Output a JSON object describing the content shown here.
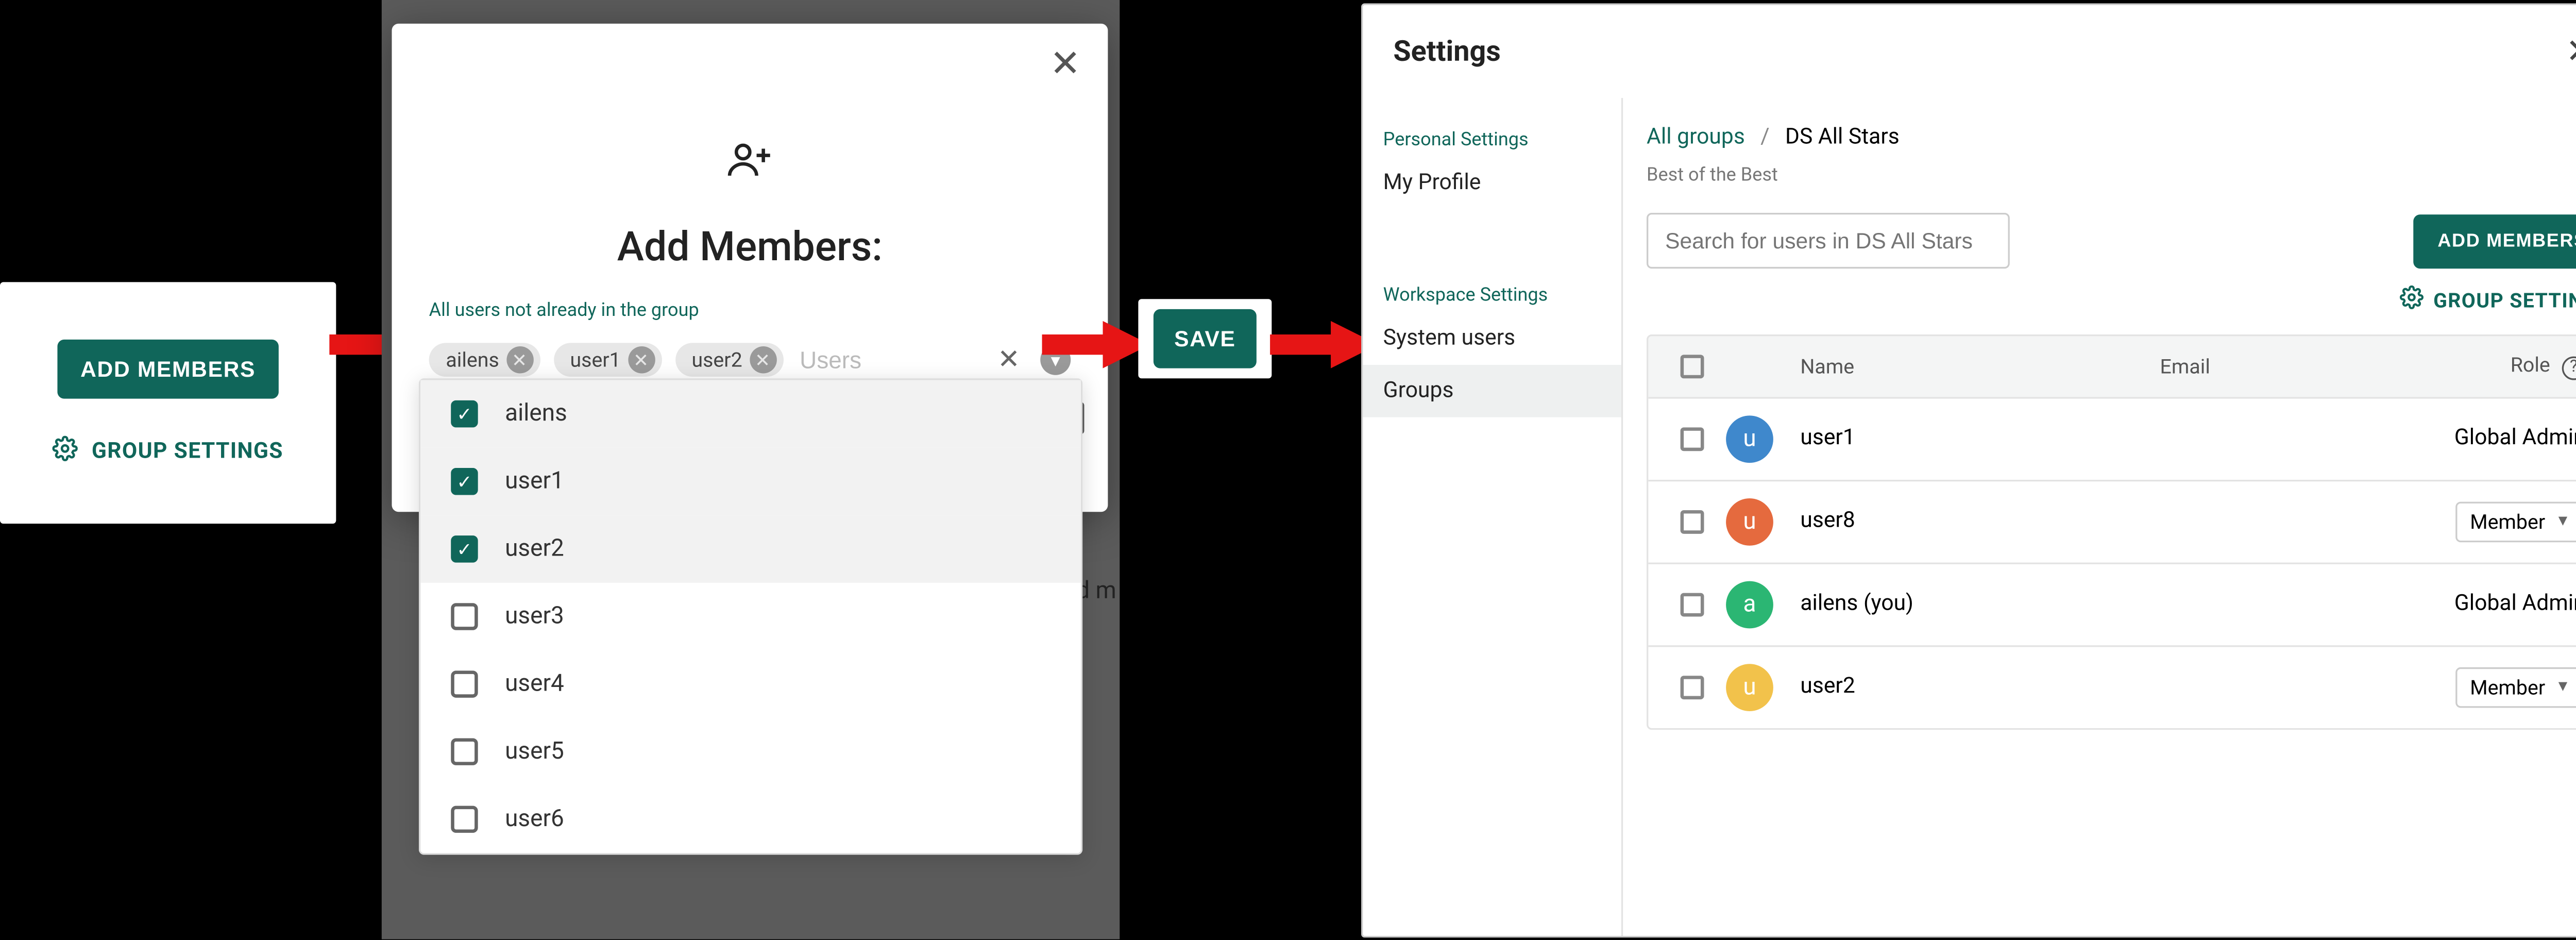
{
  "panel1": {
    "add_members_btn": "ADD MEMBERS",
    "group_settings_link": "GROUP SETTINGS"
  },
  "dialog": {
    "title": "Add Members:",
    "chip_label": "All users not already in the group",
    "placeholder": "Users",
    "close_tooltip": "Close",
    "chips": [
      {
        "label": "ailens"
      },
      {
        "label": "user1"
      },
      {
        "label": "user2"
      }
    ],
    "options": [
      {
        "label": "ailens",
        "checked": true
      },
      {
        "label": "user1",
        "checked": true
      },
      {
        "label": "user2",
        "checked": true
      },
      {
        "label": "user3",
        "checked": false
      },
      {
        "label": "user4",
        "checked": false
      },
      {
        "label": "user5",
        "checked": false
      },
      {
        "label": "user6",
        "checked": false
      }
    ],
    "peek_text": "Add m"
  },
  "save_btn": "SAVE",
  "settings": {
    "title": "Settings",
    "sidebar": {
      "personal_heading": "Personal Settings",
      "my_profile": "My Profile",
      "workspace_heading": "Workspace Settings",
      "system_users": "System users",
      "groups": "Groups"
    },
    "breadcrumb": {
      "root": "All groups",
      "current": "DS All Stars"
    },
    "subtitle": "Best of the Best",
    "search_placeholder": "Search for users in DS All Stars",
    "add_members_btn": "ADD MEMBERS",
    "group_settings_link": "GROUP SETTINGS",
    "table": {
      "headers": {
        "name": "Name",
        "email": "Email",
        "role": "Role"
      },
      "rows": [
        {
          "initial": "u",
          "color": "#3f88cc",
          "name": "user1",
          "email": "",
          "role_text": "Global Admin",
          "role_pill": false
        },
        {
          "initial": "u",
          "color": "#e56a3e",
          "name": "user8",
          "email": "",
          "role_text": "Member",
          "role_pill": true
        },
        {
          "initial": "a",
          "color": "#2bb673",
          "name": "ailens (you)",
          "email": "",
          "role_text": "Global Admin",
          "role_pill": false
        },
        {
          "initial": "u",
          "color": "#f2c24b",
          "name": "user2",
          "email": "",
          "role_text": "Member",
          "role_pill": true
        }
      ]
    }
  }
}
